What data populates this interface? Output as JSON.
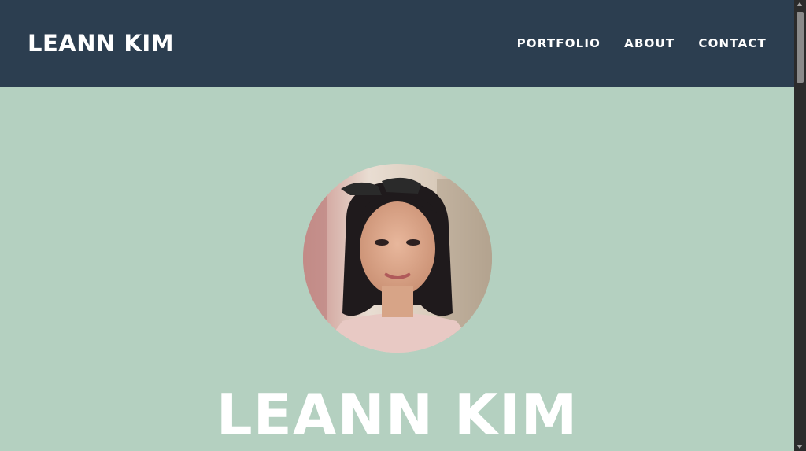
{
  "navbar": {
    "brand": "LEANN KIM",
    "links": [
      {
        "label": "PORTFOLIO"
      },
      {
        "label": "ABOUT"
      },
      {
        "label": "CONTACT"
      }
    ]
  },
  "masthead": {
    "avatar_description": "profile photo",
    "heading": "LEANN KIM"
  },
  "colors": {
    "navbar_bg": "#2c3e50",
    "masthead_bg": "#b4d0c0",
    "text": "#ffffff"
  }
}
